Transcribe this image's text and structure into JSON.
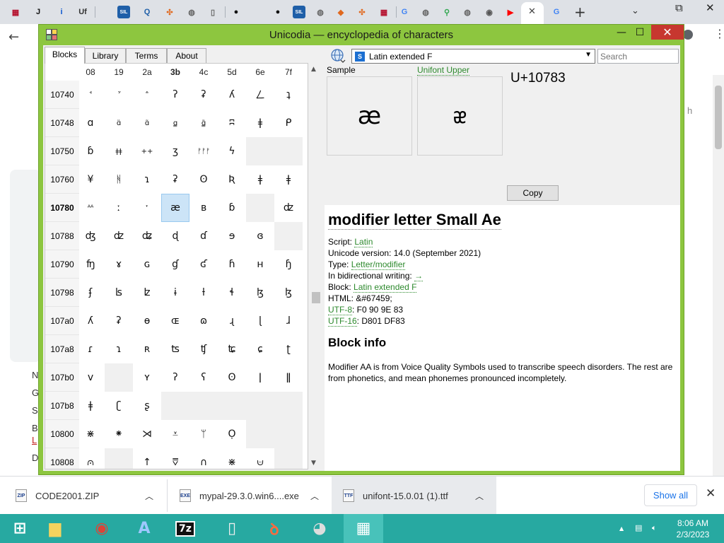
{
  "browser": {
    "tab_icons": [
      {
        "name": "tab-icon-1",
        "glyph": "▦",
        "color": "#b5112e"
      },
      {
        "name": "tab-icon-2",
        "glyph": "J",
        "color": "#111"
      },
      {
        "name": "tab-icon-3",
        "glyph": "i",
        "color": "#0b57d0"
      },
      {
        "name": "tab-icon-4",
        "glyph": "Uf",
        "color": "#333"
      },
      {
        "name": "tab-icon-5",
        "glyph": "SIL",
        "color": "#1f5fa8"
      },
      {
        "name": "tab-icon-6",
        "glyph": "Q",
        "color": "#1f5fa8"
      },
      {
        "name": "tab-icon-7",
        "glyph": "✣",
        "color": "#e0681e"
      },
      {
        "name": "tab-icon-8",
        "glyph": "◍",
        "color": "#666"
      },
      {
        "name": "tab-icon-9",
        "glyph": "▯",
        "color": "#666"
      },
      {
        "name": "tab-icon-10",
        "glyph": "●",
        "color": "#111"
      },
      {
        "name": "tab-icon-11",
        "glyph": "●",
        "color": "#111"
      },
      {
        "name": "tab-icon-12",
        "glyph": "SIL",
        "color": "#1f5fa8"
      },
      {
        "name": "tab-icon-13",
        "glyph": "◍",
        "color": "#666"
      },
      {
        "name": "tab-icon-14",
        "glyph": "◆",
        "color": "#e0681e"
      },
      {
        "name": "tab-icon-15",
        "glyph": "✣",
        "color": "#e0681e"
      },
      {
        "name": "tab-icon-16",
        "glyph": "▦",
        "color": "#b5112e"
      },
      {
        "name": "tab-icon-17",
        "glyph": "G",
        "color": "#4285f4"
      },
      {
        "name": "tab-icon-18",
        "glyph": "◍",
        "color": "#666"
      },
      {
        "name": "tab-icon-19",
        "glyph": "⚲",
        "color": "#34a853"
      },
      {
        "name": "tab-icon-20",
        "glyph": "◍",
        "color": "#666"
      },
      {
        "name": "tab-icon-21",
        "glyph": "◉",
        "color": "#555"
      },
      {
        "name": "tab-icon-22",
        "glyph": "▶",
        "color": "#ff0000"
      }
    ],
    "active_tab_close": "✕",
    "new_tab": "+",
    "background_letters": [
      "N",
      "G",
      "S",
      "B",
      "L",
      "D"
    ],
    "background_right_text": "h"
  },
  "window": {
    "title": "Unicodia — encyclopedia of characters",
    "minimize": "—",
    "maximize": "☐",
    "close": "✕"
  },
  "tabs": [
    {
      "label": "Blocks"
    },
    {
      "label": "Library"
    },
    {
      "label": "Terms"
    },
    {
      "label": "About"
    }
  ],
  "grid": {
    "columns": [
      "08",
      "19",
      "2a",
      "3b",
      "4c",
      "5d",
      "6e",
      "7f"
    ],
    "bold_column": "3b",
    "rows": [
      {
        "label": "10740",
        "cells": [
          "ꜗ",
          "ꜘ",
          "ꜙ",
          "ʔ",
          "ʡ",
          "ʎ",
          "ㄥ",
          "ʇ"
        ]
      },
      {
        "label": "10748",
        "cells": [
          "ɑ",
          "ɑ̈",
          "ɑ̃",
          "ɑ̳",
          "ɑ̳̃",
          "ʭ",
          "ǂ",
          "ᑭ"
        ]
      },
      {
        "label": "10750",
        "cells": [
          "ɓ",
          "ǂǂ",
          "++",
          "ʒ",
          "ᚠᚠᚠ",
          "ϟ",
          "",
          ""
        ]
      },
      {
        "label": "10760",
        "cells": [
          "¥",
          "ᚻ",
          "ɿ",
          "ʡ",
          "ʘ",
          "Ʀ",
          "ǂ",
          "ǂ"
        ]
      },
      {
        "label": "10780",
        "bold": true,
        "cells": [
          "ᴬᴬ",
          "ː",
          "ˑ",
          "æ",
          "ʙ",
          "ɓ",
          "",
          "ʣ"
        ]
      },
      {
        "label": "10788",
        "cells": [
          "ʤ",
          "ʣ",
          "ʥ",
          "ɖ",
          "ɗ",
          "ɘ",
          "ɞ",
          ""
        ]
      },
      {
        "label": "10790",
        "cells": [
          "ʩ",
          "ɤ",
          "ɢ",
          "ɠ",
          "ʛ",
          "ɦ",
          "ʜ",
          "ɧ"
        ]
      },
      {
        "label": "10798",
        "cells": [
          "ʄ",
          "ʪ",
          "ʫ",
          "ɨ",
          "ƚ",
          "ɬ",
          "ɮ",
          "ɮ"
        ]
      },
      {
        "label": "107a0",
        "cells": [
          "ʎ",
          "ʡ",
          "ɵ",
          "ɶ",
          "ɷ",
          "ɻ",
          "ɭ",
          "ɺ"
        ]
      },
      {
        "label": "107a8",
        "cells": [
          "ɾ",
          "ɿ",
          "ʀ",
          "ʦ",
          "ʧ",
          "ʨ",
          "ɕ",
          "ʈ"
        ]
      },
      {
        "label": "107b0",
        "cells": [
          "ᴠ",
          "",
          "ʏ",
          "ʔ",
          "ʕ",
          "ʘ",
          "ǀ",
          "ǁ"
        ]
      },
      {
        "label": "107b8",
        "cells": [
          "ǂ",
          "ʗ",
          "ʂ",
          "",
          "",
          "",
          "",
          ""
        ]
      },
      {
        "label": "10800",
        "cells": [
          "⋇",
          "⁕",
          "⋊",
          "⩡",
          "ᛘ",
          "Ọ",
          "",
          ""
        ]
      },
      {
        "label": "10808",
        "cells": [
          "⩀",
          "",
          "↑",
          "⩢",
          "∩",
          "⋇",
          "⩁",
          ""
        ]
      }
    ],
    "selected": {
      "row": "10780",
      "col": "3b"
    }
  },
  "detail": {
    "block_name": "Latin extended F",
    "search_placeholder": "Search",
    "sample_label": "Sample",
    "unifont_label": "Unifont Upper",
    "sample_glyph": "æ",
    "unifont_glyph": "ᴂ",
    "codepoint": "U+10783",
    "copy_label": "Copy",
    "char_name": "modifier letter Small Ae",
    "fields": [
      {
        "key": "Script: ",
        "value": "Latin",
        "link": true
      },
      {
        "key": "Unicode version: ",
        "value": "14.0 (September 2021)",
        "link": false
      },
      {
        "key": "Type: ",
        "value": "Letter/modifier",
        "link": true
      },
      {
        "key": "In bidirectional writing: ",
        "value": "→",
        "link": true
      },
      {
        "key": "Block: ",
        "value": "Latin extended F",
        "link": true
      },
      {
        "key": "HTML: ",
        "value": "&#67459;",
        "link": false
      },
      {
        "key": "UTF-8",
        "value": ": F0 90 9E 83",
        "link": false,
        "keylink": true
      },
      {
        "key": "UTF-16",
        "value": ": D801 DF83",
        "link": false,
        "keylink": true
      }
    ],
    "block_info_title": "Block info",
    "block_info_text": "Modifier AA is from Voice Quality Symbols used to transcribe speech disorders. The rest are from phonetics, and mean phonemes pronounced incompletely."
  },
  "downloads": {
    "items": [
      {
        "name": "CODE2001.ZIP",
        "icon": "ZIP"
      },
      {
        "name": "mypal-29.3.0.win6....exe",
        "icon": "EXE"
      },
      {
        "name": "unifont-15.0.01 (1).ttf",
        "icon": "TTF"
      }
    ],
    "show_all": "Show all",
    "close": "✕"
  },
  "taskbar": {
    "items": [
      {
        "name": "start-button",
        "glyph": "⊞",
        "color": "#ffffff"
      },
      {
        "name": "file-explorer-taskbar-icon",
        "glyph": "▆",
        "color": "#f4d35e"
      },
      {
        "name": "chrome-taskbar-icon",
        "glyph": "◉",
        "color": "#db4437"
      },
      {
        "name": "font-app-taskbar-icon",
        "glyph": "A",
        "color": "#9ec8ff"
      },
      {
        "name": "7zip-taskbar-icon",
        "glyph": "7z",
        "color": "#ffffff"
      },
      {
        "name": "document-taskbar-icon",
        "glyph": "▯",
        "color": "#eeeeee"
      },
      {
        "name": "office-taskbar-icon",
        "glyph": "ꝺ",
        "color": "#ff6a3d"
      },
      {
        "name": "raccoon-taskbar-icon",
        "glyph": "◕",
        "color": "#dddddd"
      },
      {
        "name": "unicodia-taskbar-icon",
        "glyph": "▦",
        "color": "#ffffff"
      }
    ],
    "tray_arrow": "▲",
    "time": "8:06 AM",
    "date": "2/3/2023"
  }
}
